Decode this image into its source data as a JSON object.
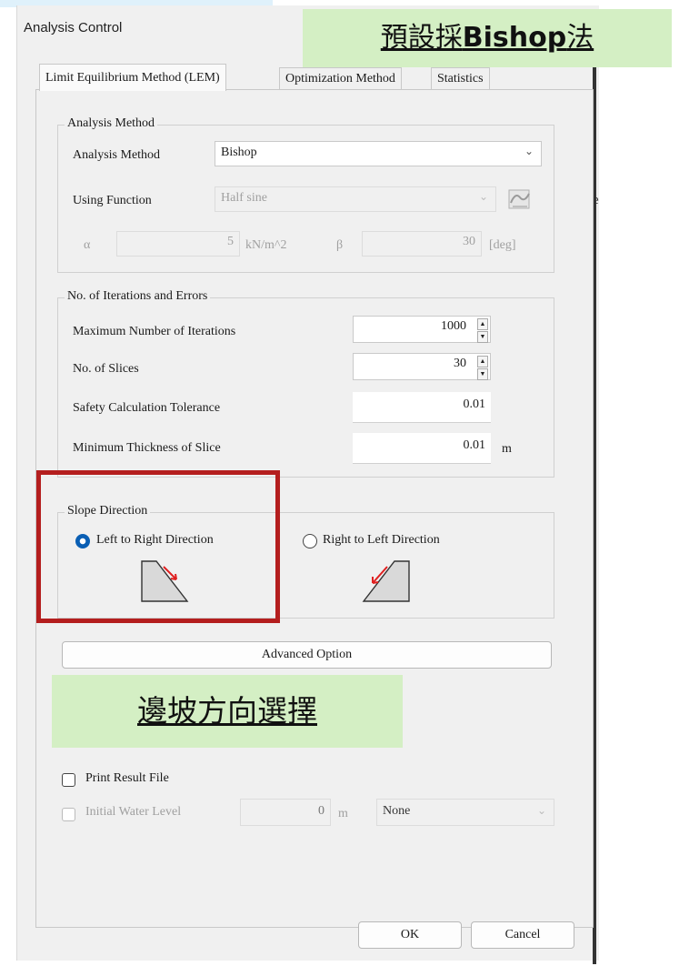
{
  "window": {
    "title": "Analysis Control"
  },
  "callouts": {
    "default_method": {
      "prefix": "預設採",
      "method": "Bishop",
      "suffix": "法"
    },
    "slope_direction": "邊坡方向選擇"
  },
  "tabs": [
    {
      "label": "Limit Equilibrium Method (LEM)",
      "active": true
    },
    {
      "label": "Optimization Method",
      "active": false
    },
    {
      "label": "Statistics",
      "active": false
    }
  ],
  "analysis_method": {
    "group_title": "Analysis Method",
    "method_label": "Analysis Method",
    "method_value": "Bishop",
    "function_label": "Using Function",
    "function_value": "Half sine",
    "alpha_symbol": "α",
    "alpha_value": "5",
    "alpha_unit": "kN/m^2",
    "beta_symbol": "β",
    "beta_value": "30",
    "beta_unit": "[deg]"
  },
  "iterations": {
    "group_title": "No. of Iterations and Errors",
    "max_iter_label": "Maximum Number of Iterations",
    "max_iter_value": "1000",
    "slices_label": "No. of Slices",
    "slices_value": "30",
    "tolerance_label": "Safety Calculation Tolerance",
    "tolerance_value": "0.01",
    "min_thickness_label": "Minimum Thickness of Slice",
    "min_thickness_value": "0.01",
    "min_thickness_unit": "m"
  },
  "slope_direction": {
    "group_title": "Slope Direction",
    "left_to_right": "Left to Right Direction",
    "right_to_left": "Right to Left Direction",
    "selected": "left_to_right"
  },
  "advanced_button": "Advanced Option",
  "print_result": {
    "label": "Print Result File",
    "checked": false
  },
  "water_level": {
    "label": "Initial Water Level",
    "value": "0",
    "unit": "m",
    "dropdown": "None"
  },
  "buttons": {
    "ok": "OK",
    "cancel": "Cancel"
  },
  "colors": {
    "highlight_red": "#b41e1e",
    "callout_green": "#d4efc4",
    "radio_blue": "#0a5fb4"
  }
}
